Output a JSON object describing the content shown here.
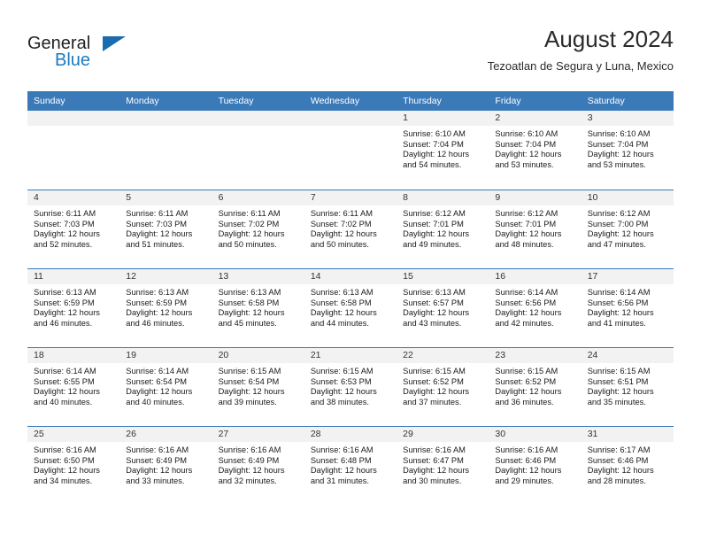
{
  "brand": {
    "name_top": "General",
    "name_bottom": "Blue",
    "accent_color": "#1a7bc0",
    "triangle_icon": "triangle-icon"
  },
  "header": {
    "title": "August 2024",
    "subtitle": "Tezoatlan de Segura y Luna, Mexico"
  },
  "theme": {
    "header_blue": "#3b7ab8",
    "daynum_band": "#f2f2f2",
    "text": "#1a1a1a"
  },
  "calendar": {
    "weekday_headers": [
      "Sunday",
      "Monday",
      "Tuesday",
      "Wednesday",
      "Thursday",
      "Friday",
      "Saturday"
    ],
    "weeks": [
      [
        {
          "day": "",
          "lines": []
        },
        {
          "day": "",
          "lines": []
        },
        {
          "day": "",
          "lines": []
        },
        {
          "day": "",
          "lines": []
        },
        {
          "day": "1",
          "lines": [
            "Sunrise: 6:10 AM",
            "Sunset: 7:04 PM",
            "Daylight: 12 hours",
            "and 54 minutes."
          ]
        },
        {
          "day": "2",
          "lines": [
            "Sunrise: 6:10 AM",
            "Sunset: 7:04 PM",
            "Daylight: 12 hours",
            "and 53 minutes."
          ]
        },
        {
          "day": "3",
          "lines": [
            "Sunrise: 6:10 AM",
            "Sunset: 7:04 PM",
            "Daylight: 12 hours",
            "and 53 minutes."
          ]
        }
      ],
      [
        {
          "day": "4",
          "lines": [
            "Sunrise: 6:11 AM",
            "Sunset: 7:03 PM",
            "Daylight: 12 hours",
            "and 52 minutes."
          ]
        },
        {
          "day": "5",
          "lines": [
            "Sunrise: 6:11 AM",
            "Sunset: 7:03 PM",
            "Daylight: 12 hours",
            "and 51 minutes."
          ]
        },
        {
          "day": "6",
          "lines": [
            "Sunrise: 6:11 AM",
            "Sunset: 7:02 PM",
            "Daylight: 12 hours",
            "and 50 minutes."
          ]
        },
        {
          "day": "7",
          "lines": [
            "Sunrise: 6:11 AM",
            "Sunset: 7:02 PM",
            "Daylight: 12 hours",
            "and 50 minutes."
          ]
        },
        {
          "day": "8",
          "lines": [
            "Sunrise: 6:12 AM",
            "Sunset: 7:01 PM",
            "Daylight: 12 hours",
            "and 49 minutes."
          ]
        },
        {
          "day": "9",
          "lines": [
            "Sunrise: 6:12 AM",
            "Sunset: 7:01 PM",
            "Daylight: 12 hours",
            "and 48 minutes."
          ]
        },
        {
          "day": "10",
          "lines": [
            "Sunrise: 6:12 AM",
            "Sunset: 7:00 PM",
            "Daylight: 12 hours",
            "and 47 minutes."
          ]
        }
      ],
      [
        {
          "day": "11",
          "lines": [
            "Sunrise: 6:13 AM",
            "Sunset: 6:59 PM",
            "Daylight: 12 hours",
            "and 46 minutes."
          ]
        },
        {
          "day": "12",
          "lines": [
            "Sunrise: 6:13 AM",
            "Sunset: 6:59 PM",
            "Daylight: 12 hours",
            "and 46 minutes."
          ]
        },
        {
          "day": "13",
          "lines": [
            "Sunrise: 6:13 AM",
            "Sunset: 6:58 PM",
            "Daylight: 12 hours",
            "and 45 minutes."
          ]
        },
        {
          "day": "14",
          "lines": [
            "Sunrise: 6:13 AM",
            "Sunset: 6:58 PM",
            "Daylight: 12 hours",
            "and 44 minutes."
          ]
        },
        {
          "day": "15",
          "lines": [
            "Sunrise: 6:13 AM",
            "Sunset: 6:57 PM",
            "Daylight: 12 hours",
            "and 43 minutes."
          ]
        },
        {
          "day": "16",
          "lines": [
            "Sunrise: 6:14 AM",
            "Sunset: 6:56 PM",
            "Daylight: 12 hours",
            "and 42 minutes."
          ]
        },
        {
          "day": "17",
          "lines": [
            "Sunrise: 6:14 AM",
            "Sunset: 6:56 PM",
            "Daylight: 12 hours",
            "and 41 minutes."
          ]
        }
      ],
      [
        {
          "day": "18",
          "lines": [
            "Sunrise: 6:14 AM",
            "Sunset: 6:55 PM",
            "Daylight: 12 hours",
            "and 40 minutes."
          ]
        },
        {
          "day": "19",
          "lines": [
            "Sunrise: 6:14 AM",
            "Sunset: 6:54 PM",
            "Daylight: 12 hours",
            "and 40 minutes."
          ]
        },
        {
          "day": "20",
          "lines": [
            "Sunrise: 6:15 AM",
            "Sunset: 6:54 PM",
            "Daylight: 12 hours",
            "and 39 minutes."
          ]
        },
        {
          "day": "21",
          "lines": [
            "Sunrise: 6:15 AM",
            "Sunset: 6:53 PM",
            "Daylight: 12 hours",
            "and 38 minutes."
          ]
        },
        {
          "day": "22",
          "lines": [
            "Sunrise: 6:15 AM",
            "Sunset: 6:52 PM",
            "Daylight: 12 hours",
            "and 37 minutes."
          ]
        },
        {
          "day": "23",
          "lines": [
            "Sunrise: 6:15 AM",
            "Sunset: 6:52 PM",
            "Daylight: 12 hours",
            "and 36 minutes."
          ]
        },
        {
          "day": "24",
          "lines": [
            "Sunrise: 6:15 AM",
            "Sunset: 6:51 PM",
            "Daylight: 12 hours",
            "and 35 minutes."
          ]
        }
      ],
      [
        {
          "day": "25",
          "lines": [
            "Sunrise: 6:16 AM",
            "Sunset: 6:50 PM",
            "Daylight: 12 hours",
            "and 34 minutes."
          ]
        },
        {
          "day": "26",
          "lines": [
            "Sunrise: 6:16 AM",
            "Sunset: 6:49 PM",
            "Daylight: 12 hours",
            "and 33 minutes."
          ]
        },
        {
          "day": "27",
          "lines": [
            "Sunrise: 6:16 AM",
            "Sunset: 6:49 PM",
            "Daylight: 12 hours",
            "and 32 minutes."
          ]
        },
        {
          "day": "28",
          "lines": [
            "Sunrise: 6:16 AM",
            "Sunset: 6:48 PM",
            "Daylight: 12 hours",
            "and 31 minutes."
          ]
        },
        {
          "day": "29",
          "lines": [
            "Sunrise: 6:16 AM",
            "Sunset: 6:47 PM",
            "Daylight: 12 hours",
            "and 30 minutes."
          ]
        },
        {
          "day": "30",
          "lines": [
            "Sunrise: 6:16 AM",
            "Sunset: 6:46 PM",
            "Daylight: 12 hours",
            "and 29 minutes."
          ]
        },
        {
          "day": "31",
          "lines": [
            "Sunrise: 6:17 AM",
            "Sunset: 6:46 PM",
            "Daylight: 12 hours",
            "and 28 minutes."
          ]
        }
      ]
    ]
  }
}
